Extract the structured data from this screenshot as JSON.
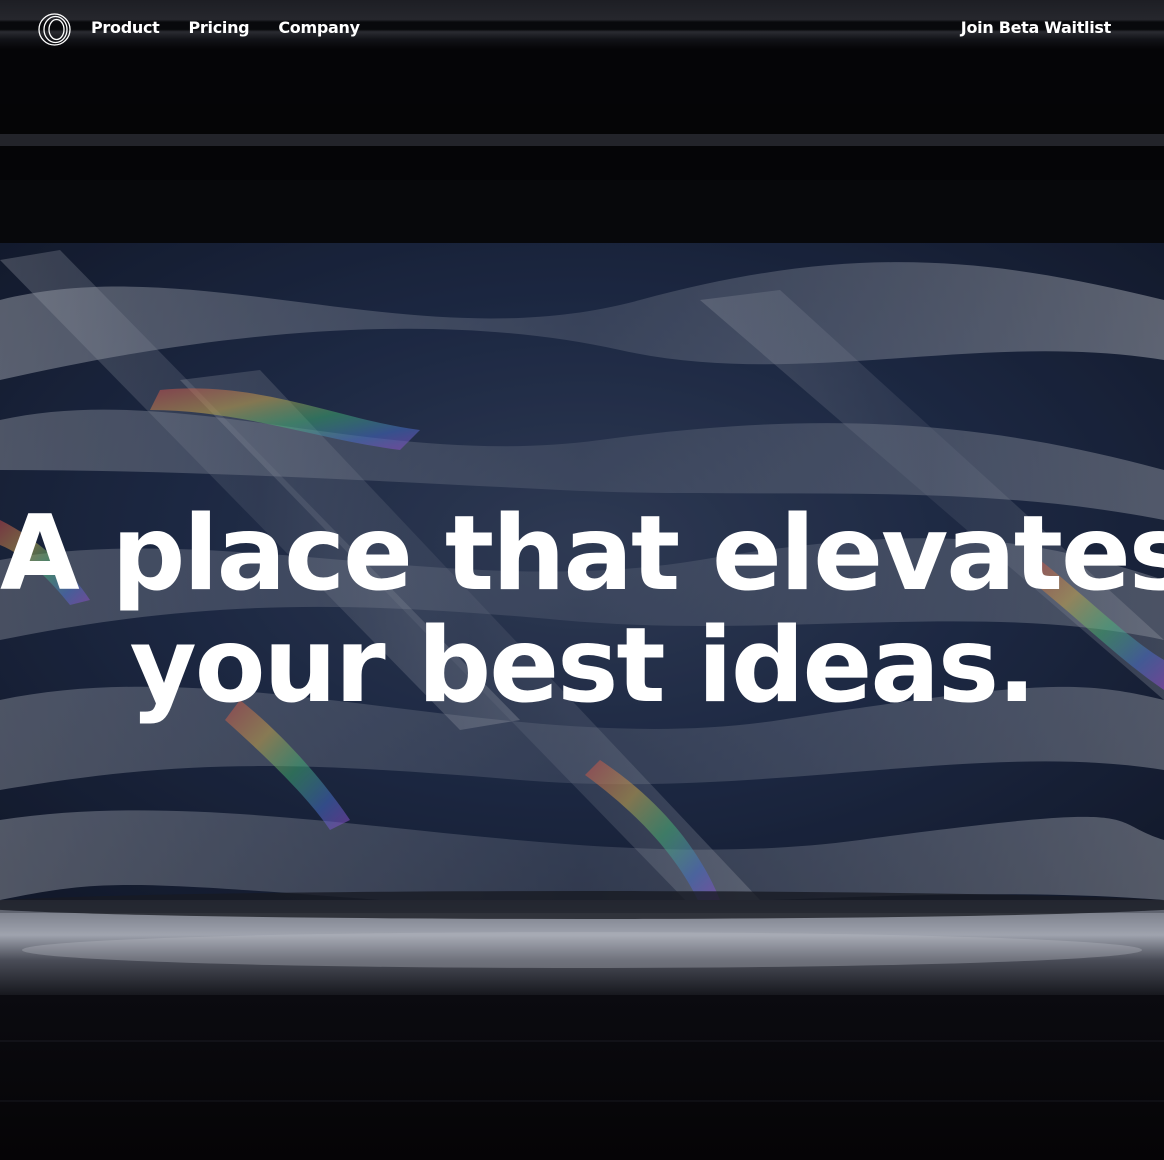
{
  "nav": {
    "logo_icon": "concentric-rings-logo-icon",
    "links": [
      "Product",
      "Pricing",
      "Company"
    ],
    "cta_label": "Join Beta Waitlist"
  },
  "hero": {
    "headline_line1": "A place that elevates",
    "headline_line2": "your best ideas."
  },
  "colors": {
    "text": "#ffffff",
    "background": "#0a0b10",
    "accent_blue": "#1b2a4a"
  }
}
